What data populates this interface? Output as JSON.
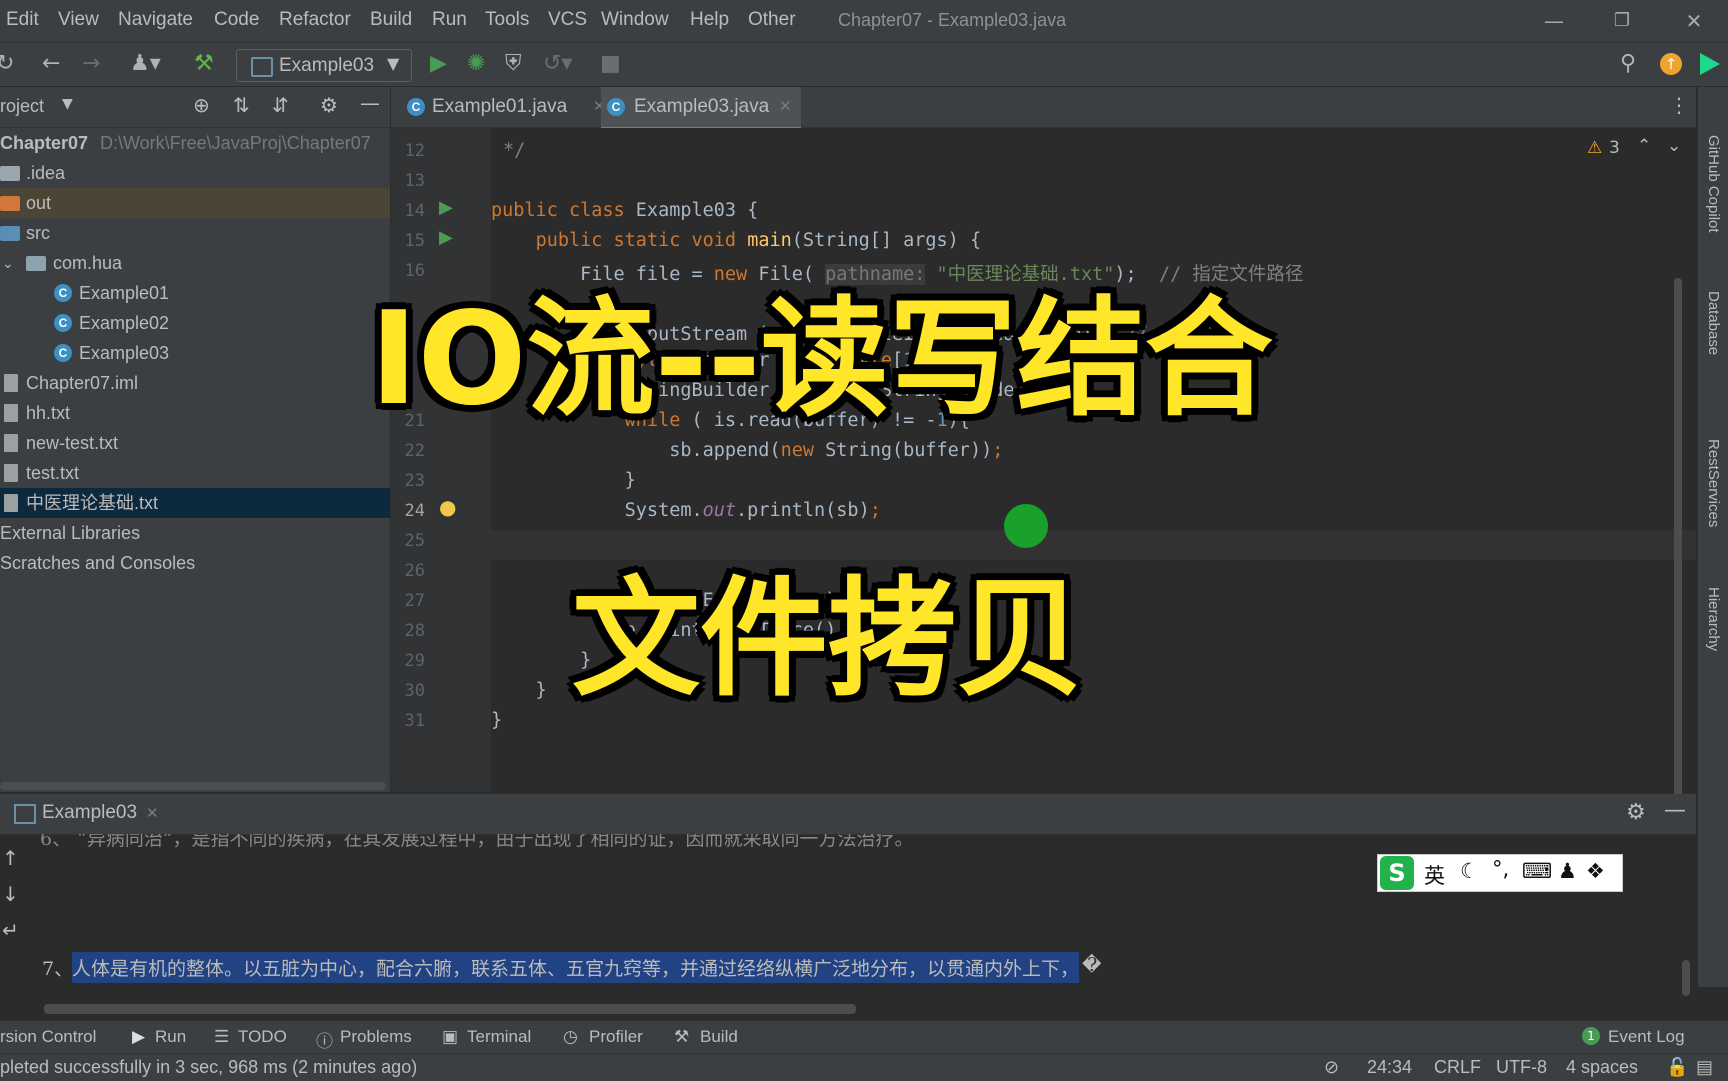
{
  "menubar": {
    "items": [
      "Edit",
      "View",
      "Navigate",
      "Code",
      "Refactor",
      "Build",
      "Run",
      "Tools",
      "VCS",
      "Window",
      "Help",
      "Other"
    ],
    "window_title": "Chapter07 - Example03.java"
  },
  "toolbar": {
    "run_config": "Example03"
  },
  "project": {
    "header_label": "roject",
    "root_name": "Chapter07",
    "root_path": "D:\\Work\\Free\\JavaProj\\Chapter07",
    "items": [
      ".idea",
      "out",
      "src",
      "com.hua",
      "Example01",
      "Example02",
      "Example03",
      "Chapter07.iml",
      "hh.txt",
      "new-test.txt",
      "test.txt",
      "中医理论基础.txt",
      "External Libraries",
      "Scratches and Consoles"
    ]
  },
  "editor": {
    "tabs": [
      "Example01.java",
      "Example03.java"
    ],
    "active_tab": "Example03.java",
    "warnings_count": "3",
    "line_numbers": [
      "12",
      "13",
      "14",
      "15",
      "16",
      "",
      "",
      "",
      "21",
      "22",
      "23",
      "24",
      "25",
      "26",
      "27",
      "28",
      "29",
      "30",
      "31"
    ]
  },
  "right_sidebar": {
    "items": [
      "GitHub Copilot",
      "Database",
      "RestServices",
      "Hierarchy"
    ]
  },
  "run_panel": {
    "tab_label": "Example03",
    "partial_line": "6、 “异病同治”，是指不同的疾病，在其发展过程中，由于出现了相同的证，因而就采取同一方法治疗。",
    "line_number": "7、",
    "selected_line": "人体是有机的整体。以五脏为中心，配合六腑，联系五体、五官九窍等，并通过经络纵横广泛地分布，以贯通内外上下，"
  },
  "ime": {
    "lang": "英"
  },
  "bottom_tabs": {
    "items": [
      "rsion Control",
      "Run",
      "TODO",
      "Problems",
      "Terminal",
      "Profiler",
      "Build"
    ],
    "event_log": "Event Log",
    "event_count": "1"
  },
  "status_bar": {
    "message": "pleted successfully in 3 sec, 968 ms (2 minutes ago)",
    "position": "24:34",
    "line_sep": "CRLF",
    "encoding": "UTF-8",
    "indent": "4 spaces"
  },
  "overlay": {
    "title_line1": "IO流--读写结合",
    "title_line2": "文件拷贝"
  },
  "colors": {
    "overlay_text": "#ffe629",
    "selection": "#214283",
    "run_green": "#499c54"
  }
}
